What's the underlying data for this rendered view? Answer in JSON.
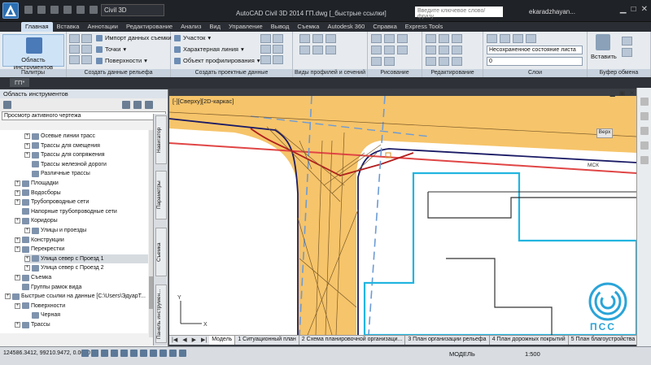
{
  "titlebar": {
    "workspace": "Civil 3D",
    "app_title": "AutoCAD Civil 3D 2014   ГП.dwg [_быстрые ссылки]",
    "search_placeholder": "Введите ключевое слово/фразу",
    "user": "ekaradzhayan..."
  },
  "ribbon_tabs": [
    "Главная",
    "Вставка",
    "Аннотации",
    "Редактирование",
    "Анализ",
    "Вид",
    "Управление",
    "Вывод",
    "Съемка",
    "Autodesk 360",
    "Справка",
    "Express Tools"
  ],
  "ribbon": {
    "tool_area_label": "Область инструментов",
    "palettes_label": "Палитры",
    "import_label": "Импорт данных съемки",
    "points_label": "Точки",
    "surfaces_label": "Поверхности",
    "create_ground_label": "Создать данные рельефа",
    "parcel_label": "Участок",
    "feature_line_label": "Характерная линия",
    "grading_label": "Объект профилирования",
    "create_design_label": "Создать проектные данные",
    "profile_views_label": "Виды профилей и сечений",
    "draw_label": "Рисование",
    "modify_label": "Редактирование",
    "layer_state": "Несохраненное состояние листа",
    "layer_value": "0",
    "layers_label": "Слои",
    "paste_label": "Вставить",
    "clipboard_label": "Буфер обмена"
  },
  "document_tab": "ГП*",
  "toolspace": {
    "title": "Область инструментов",
    "view_select": "Просмотр активного чертежа",
    "side_tabs": [
      "Навигатор",
      "Параметры",
      "Съемка",
      "Панель инструмен..."
    ],
    "tree": [
      {
        "label": "Осевые линии трасс",
        "level": 2,
        "exp": true
      },
      {
        "label": "Трассы для смещения",
        "level": 2,
        "exp": true
      },
      {
        "label": "Трассы для сопряжения",
        "level": 2,
        "exp": true
      },
      {
        "label": "Трассы железной дороги",
        "level": 2,
        "exp": false
      },
      {
        "label": "Различные трассы",
        "level": 2,
        "exp": false
      },
      {
        "label": "Площадки",
        "level": 1,
        "exp": true
      },
      {
        "label": "Водосборы",
        "level": 1,
        "exp": true
      },
      {
        "label": "Трубопроводные сети",
        "level": 1,
        "exp": true
      },
      {
        "label": "Напорные трубопроводные сети",
        "level": 1,
        "exp": false
      },
      {
        "label": "Коридоры",
        "level": 1,
        "exp": true
      },
      {
        "label": "Улицы и проезды",
        "level": 2,
        "exp": true
      },
      {
        "label": "Конструкции",
        "level": 1,
        "exp": true
      },
      {
        "label": "Перекрестки",
        "level": 1,
        "exp": true
      },
      {
        "label": "Улица север с Проезд 1",
        "level": 2,
        "exp": true,
        "sel": true
      },
      {
        "label": "Улица север с Проезд 2",
        "level": 2,
        "exp": true
      },
      {
        "label": "Съемка",
        "level": 1,
        "exp": true
      },
      {
        "label": "Группы рамок вида",
        "level": 1,
        "exp": false
      },
      {
        "label": "Быстрые ссылки на данные [C:\\Users\\ЭдуарТ...",
        "level": 0,
        "exp": true
      },
      {
        "label": "Поверхности",
        "level": 1,
        "exp": true
      },
      {
        "label": "Черная",
        "level": 2,
        "exp": false
      },
      {
        "label": "Трассы",
        "level": 1,
        "exp": true
      }
    ]
  },
  "viewport": {
    "label": "[-][Сверху][2D-каркас]",
    "viewcube_label": "Верх",
    "wcs_label": "МСК"
  },
  "layout_tabs": [
    "Модель",
    "1 Ситуационный план",
    "2 Схема планировочной организаци...",
    "3 План организации рельефа",
    "4 План дорожных покрытий",
    "5 План благоустройства озеленен..."
  ],
  "status": {
    "coords": "124586.3412, 99210.9472, 0.0000",
    "model_label": "МОДЕЛЬ",
    "scale": "1:500"
  },
  "watermark": "ПСС",
  "colors": {
    "road_fill": "#f6c46a",
    "accent": "#1aa0d8",
    "red_line": "#e04545"
  }
}
